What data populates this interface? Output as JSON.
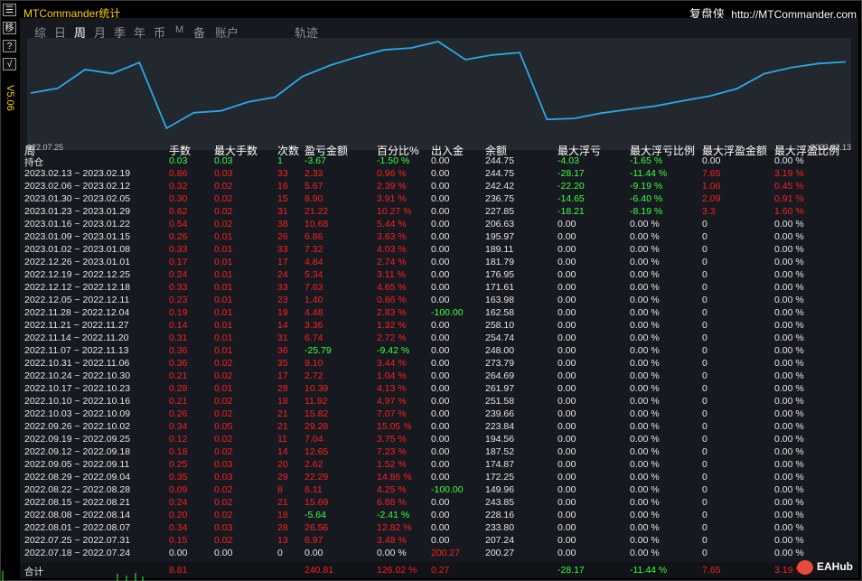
{
  "app": {
    "title": "MTCommander统计",
    "brand_name": "复盘侠",
    "brand_url": "http://MTCommander.com"
  },
  "leftbar": {
    "buttons": [
      "☰",
      "移",
      "?",
      "√"
    ],
    "version": "V5.06"
  },
  "tabs": [
    {
      "label": "综",
      "active": false
    },
    {
      "label": "日",
      "active": false
    },
    {
      "label": "周",
      "active": true
    },
    {
      "label": "月",
      "active": false
    },
    {
      "label": "季",
      "active": false
    },
    {
      "label": "年",
      "active": false
    },
    {
      "label": "币",
      "active": false
    },
    {
      "label": "M",
      "active": false
    },
    {
      "label": "备",
      "active": false
    },
    {
      "label": "账户",
      "active": false
    },
    {
      "label": "轨迹",
      "active": false
    }
  ],
  "chart_data": {
    "type": "line",
    "x_start_label": "022.07.25",
    "x_end_label": "2023.02.13",
    "values": [
      200.27,
      207.24,
      233.8,
      228.16,
      243.85,
      149.96,
      172.25,
      174.87,
      187.52,
      194.56,
      223.84,
      239.66,
      251.58,
      261.97,
      264.69,
      273.79,
      248.0,
      254.74,
      258.1,
      162.58,
      163.98,
      171.61,
      176.95,
      181.79,
      189.11,
      195.97,
      206.63,
      227.85,
      236.75,
      242.42,
      244.75
    ],
    "line_color": "#2aa8e8"
  },
  "table": {
    "headers": [
      "周",
      "手数",
      "最大手数",
      "次数",
      "盈亏金额",
      "百分比%",
      "出入金",
      "余额",
      "最大浮亏",
      "最大浮亏比例",
      "最大浮盈金额",
      "最大浮盈比例"
    ],
    "rows": [
      [
        "持仓",
        "0.03",
        "0.03",
        "1",
        "-3.67",
        "-1.50 %",
        "0.00",
        "244.75",
        "-4.03",
        "-1.65 %",
        "0.00",
        "0.00 %"
      ],
      [
        "2023.02.13 ~ 2023.02.19",
        "0.86",
        "0.03",
        "33",
        "2.33",
        "0.96 %",
        "0.00",
        "244.75",
        "-28.17",
        "-11.44 %",
        "7.65",
        "3.19 %"
      ],
      [
        "2023.02.06 ~ 2023.02.12",
        "0.32",
        "0.02",
        "16",
        "5.67",
        "2.39 %",
        "0.00",
        "242.42",
        "-22.20",
        "-9.19 %",
        "1.06",
        "0.45 %"
      ],
      [
        "2023.01.30 ~ 2023.02.05",
        "0.30",
        "0.02",
        "15",
        "8.90",
        "3.91 %",
        "0.00",
        "236.75",
        "-14.65",
        "-6.40 %",
        "2.09",
        "0.91 %"
      ],
      [
        "2023.01.23 ~ 2023.01.29",
        "0.62",
        "0.02",
        "31",
        "21.22",
        "10.27 %",
        "0.00",
        "227.85",
        "-18.21",
        "-8.19 %",
        "3.3",
        "1.60 %"
      ],
      [
        "2023.01.16 ~ 2023.01.22",
        "0.54",
        "0.02",
        "38",
        "10.68",
        "5.44 %",
        "0.00",
        "206.63",
        "0.00",
        "0.00 %",
        "0",
        "0.00 %"
      ],
      [
        "2023.01.09 ~ 2023.01.15",
        "0.26",
        "0.01",
        "26",
        "6.86",
        "3.63 %",
        "0.00",
        "195.97",
        "0.00",
        "0.00 %",
        "0",
        "0.00 %"
      ],
      [
        "2023.01.02 ~ 2023.01.08",
        "0.33",
        "0.01",
        "33",
        "7.32",
        "4.03 %",
        "0.00",
        "189.11",
        "0.00",
        "0.00 %",
        "0",
        "0.00 %"
      ],
      [
        "2022.12.26 ~ 2023.01.01",
        "0.17",
        "0.01",
        "17",
        "4.84",
        "2.74 %",
        "0.00",
        "181.79",
        "0.00",
        "0.00 %",
        "0",
        "0.00 %"
      ],
      [
        "2022.12.19 ~ 2022.12.25",
        "0.24",
        "0.01",
        "24",
        "5.34",
        "3.11 %",
        "0.00",
        "176.95",
        "0.00",
        "0.00 %",
        "0",
        "0.00 %"
      ],
      [
        "2022.12.12 ~ 2022.12.18",
        "0.33",
        "0.01",
        "33",
        "7.63",
        "4.65 %",
        "0.00",
        "171.61",
        "0.00",
        "0.00 %",
        "0",
        "0.00 %"
      ],
      [
        "2022.12.05 ~ 2022.12.11",
        "0.23",
        "0.01",
        "23",
        "1.40",
        "0.86 %",
        "0.00",
        "163.98",
        "0.00",
        "0.00 %",
        "0",
        "0.00 %"
      ],
      [
        "2022.11.28 ~ 2022.12.04",
        "0.19",
        "0.01",
        "19",
        "4.48",
        "2.83 %",
        "-100.00",
        "162.58",
        "0.00",
        "0.00 %",
        "0",
        "0.00 %"
      ],
      [
        "2022.11.21 ~ 2022.11.27",
        "0.14",
        "0.01",
        "14",
        "3.36",
        "1.32 %",
        "0.00",
        "258.10",
        "0.00",
        "0.00 %",
        "0",
        "0.00 %"
      ],
      [
        "2022.11.14 ~ 2022.11.20",
        "0.31",
        "0.01",
        "31",
        "6.74",
        "2.72 %",
        "0.00",
        "254.74",
        "0.00",
        "0.00 %",
        "0",
        "0.00 %"
      ],
      [
        "2022.11.07 ~ 2022.11.13",
        "0.36",
        "0.01",
        "36",
        "-25.79",
        "-9.42 %",
        "0.00",
        "248.00",
        "0.00",
        "0.00 %",
        "0",
        "0.00 %"
      ],
      [
        "2022.10.31 ~ 2022.11.06",
        "0.36",
        "0.02",
        "35",
        "9.10",
        "3.44 %",
        "0.00",
        "273.79",
        "0.00",
        "0.00 %",
        "0",
        "0.00 %"
      ],
      [
        "2022.10.24 ~ 2022.10.30",
        "0.21",
        "0.02",
        "17",
        "2.72",
        "1.04 %",
        "0.00",
        "264.69",
        "0.00",
        "0.00 %",
        "0",
        "0.00 %"
      ],
      [
        "2022.10.17 ~ 2022.10.23",
        "0.28",
        "0.01",
        "28",
        "10.39",
        "4.13 %",
        "0.00",
        "261.97",
        "0.00",
        "0.00 %",
        "0",
        "0.00 %"
      ],
      [
        "2022.10.10 ~ 2022.10.16",
        "0.21",
        "0.02",
        "18",
        "11.92",
        "4.97 %",
        "0.00",
        "251.58",
        "0.00",
        "0.00 %",
        "0",
        "0.00 %"
      ],
      [
        "2022.10.03 ~ 2022.10.09",
        "0.26",
        "0.02",
        "21",
        "15.82",
        "7.07 %",
        "0.00",
        "239.66",
        "0.00",
        "0.00 %",
        "0",
        "0.00 %"
      ],
      [
        "2022.09.26 ~ 2022.10.02",
        "0.34",
        "0.05",
        "21",
        "29.28",
        "15.05 %",
        "0.00",
        "223.84",
        "0.00",
        "0.00 %",
        "0",
        "0.00 %"
      ],
      [
        "2022.09.19 ~ 2022.09.25",
        "0.12",
        "0.02",
        "11",
        "7.04",
        "3.75 %",
        "0.00",
        "194.56",
        "0.00",
        "0.00 %",
        "0",
        "0.00 %"
      ],
      [
        "2022.09.12 ~ 2022.09.18",
        "0.18",
        "0.02",
        "14",
        "12.65",
        "7.23 %",
        "0.00",
        "187.52",
        "0.00",
        "0.00 %",
        "0",
        "0.00 %"
      ],
      [
        "2022.09.05 ~ 2022.09.11",
        "0.25",
        "0.03",
        "20",
        "2.62",
        "1.52 %",
        "0.00",
        "174.87",
        "0.00",
        "0.00 %",
        "0",
        "0.00 %"
      ],
      [
        "2022.08.29 ~ 2022.09.04",
        "0.35",
        "0.03",
        "29",
        "22.29",
        "14.86 %",
        "0.00",
        "172.25",
        "0.00",
        "0.00 %",
        "0",
        "0.00 %"
      ],
      [
        "2022.08.22 ~ 2022.08.28",
        "0.09",
        "0.02",
        "8",
        "6.11",
        "4.25 %",
        "-100.00",
        "149.96",
        "0.00",
        "0.00 %",
        "0",
        "0.00 %"
      ],
      [
        "2022.08.15 ~ 2022.08.21",
        "0.24",
        "0.02",
        "21",
        "15.69",
        "6.88 %",
        "0.00",
        "243.85",
        "0.00",
        "0.00 %",
        "0",
        "0.00 %"
      ],
      [
        "2022.08.08 ~ 2022.08.14",
        "0.20",
        "0.02",
        "18",
        "-5.64",
        "-2.41 %",
        "0.00",
        "228.16",
        "0.00",
        "0.00 %",
        "0",
        "0.00 %"
      ],
      [
        "2022.08.01 ~ 2022.08.07",
        "0.34",
        "0.03",
        "28",
        "26.56",
        "12.82 %",
        "0.00",
        "233.80",
        "0.00",
        "0.00 %",
        "0",
        "0.00 %"
      ],
      [
        "2022.07.25 ~ 2022.07.31",
        "0.15",
        "0.02",
        "13",
        "6.97",
        "3.48 %",
        "0.00",
        "207.24",
        "0.00",
        "0.00 %",
        "0",
        "0.00 %"
      ],
      [
        "2022.07.18 ~ 2022.07.24",
        "0.00",
        "0.00",
        "0",
        "0.00",
        "0.00 %",
        "200.27",
        "200.27",
        "0.00",
        "0.00 %",
        "0",
        "0.00 %"
      ]
    ],
    "total": [
      "合计",
      "8.81",
      "",
      "",
      "240.81",
      "126.02 %",
      "0.27",
      "",
      "-28.17",
      "-11.44 %",
      "7.65",
      "3.19 %"
    ]
  },
  "watermark": "EAHub",
  "colors": {
    "profit": "#ff1e1e",
    "loss": "#3cff3c",
    "accent": "#ffd200"
  }
}
